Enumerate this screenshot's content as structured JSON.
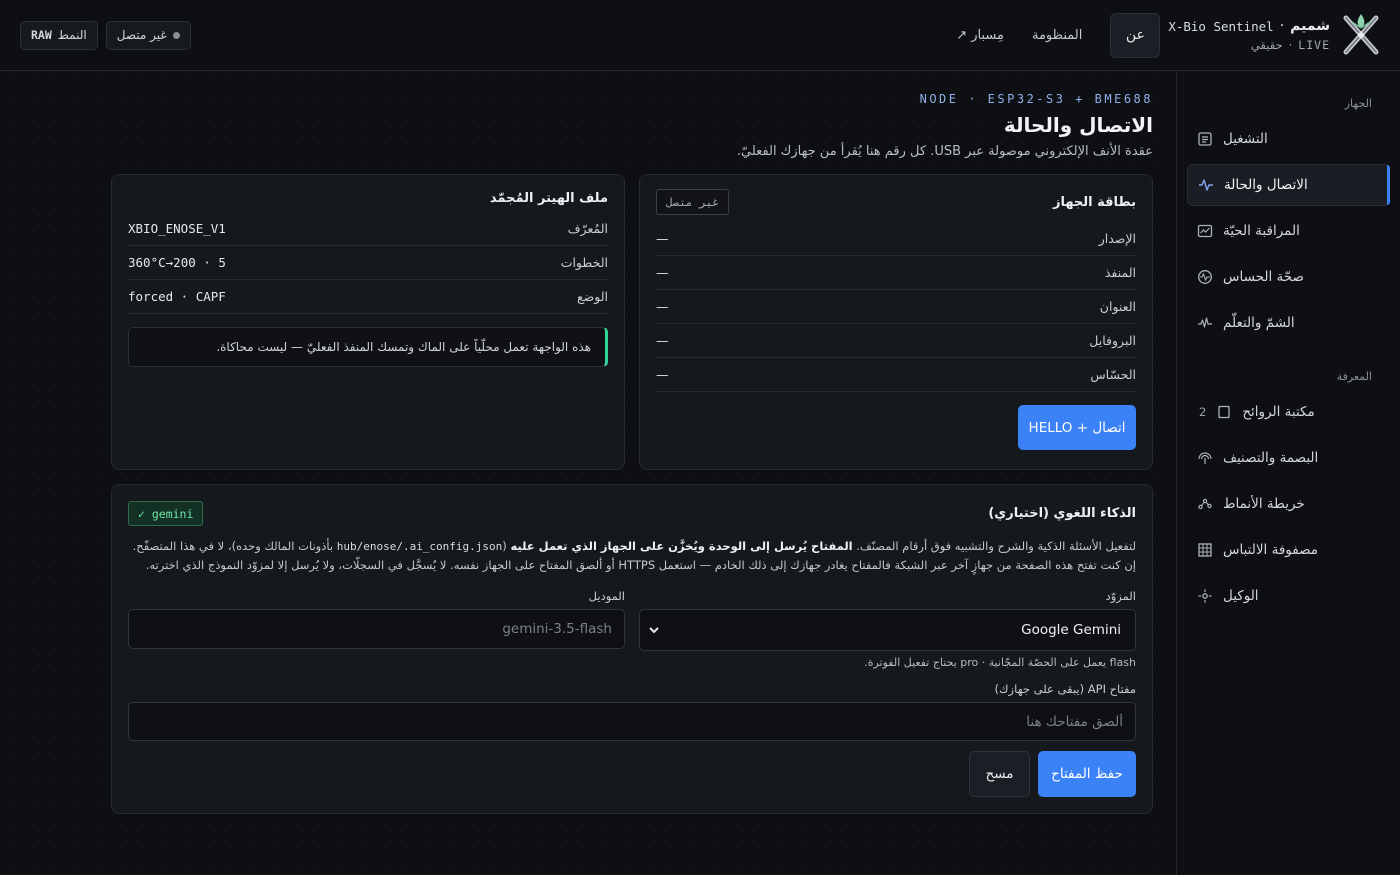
{
  "topbar": {
    "brand_name": "شميم",
    "brand_sep": "·",
    "product": "X-Bio Sentinel",
    "live": "LIVE",
    "live_sep": "·",
    "mode": "حقيقي",
    "lang": "عن",
    "nav": [
      "المنظومة",
      "مِسبار ↗"
    ],
    "status": "غير متصل",
    "mode_label": "النمط",
    "mode_value": "RAW"
  },
  "sidebar": {
    "group1": "الجهاز",
    "items1": [
      {
        "label": "التشغيل",
        "icon": "list-icon"
      },
      {
        "label": "الاتصال والحالة",
        "icon": "pulse-icon",
        "active": true
      },
      {
        "label": "المراقبة الحيّة",
        "icon": "chart-icon"
      },
      {
        "label": "صحّة الحساس",
        "icon": "heartbeat-icon"
      },
      {
        "label": "الشمّ والتعلّم",
        "icon": "signal-icon"
      }
    ],
    "group2": "المعرفة",
    "items2": [
      {
        "label": "مكتبة الروائح",
        "icon": "square-icon",
        "count": "2"
      },
      {
        "label": "البصمة والتصنيف",
        "icon": "fingerprint-icon"
      },
      {
        "label": "خريطة الأنماط",
        "icon": "scatter-icon"
      },
      {
        "label": "مصفوفة الالتباس",
        "icon": "grid-icon"
      },
      {
        "label": "الوكيل",
        "icon": "agent-icon"
      }
    ]
  },
  "main": {
    "eyebrow": "NODE · ESP32-S3 + BME688",
    "title": "الاتصال والحالة",
    "subtitle": "عقدة الأنف الإلكتروني موصولة عبر USB. كل رقم هنا يُقرأ من جهازك الفعليّ."
  },
  "device_card": {
    "title": "بطاقة الجهاز",
    "status_tag": "غير متصل",
    "rows": [
      {
        "k": "الإصدار",
        "v": "—"
      },
      {
        "k": "المنفذ",
        "v": "—"
      },
      {
        "k": "العنوان",
        "v": "—"
      },
      {
        "k": "البروفايل",
        "v": "—"
      },
      {
        "k": "الحسّاس",
        "v": "—"
      }
    ],
    "connect_label": "اتصال + HELLO"
  },
  "file_card": {
    "title": "ملف الهيتر المُجمّد",
    "rows": [
      {
        "k": "المُعرّف",
        "v": "XBIO_ENOSE_V1"
      },
      {
        "k": "الخطوات",
        "v": "5 · 200→360°C"
      },
      {
        "k": "الوضع",
        "v": "forced · CAPF"
      }
    ],
    "note": "هذه الواجهة تعمل محلّياً على الماك وتمسك المنفذ الفعليّ — ليست محاكاة."
  },
  "ai_card": {
    "title": "الذكاء اللغوي (اختياري)",
    "badge": "✓ gemini",
    "desc_1": "لتفعيل الأسئلة الذكية والشرح والتشبيه فوق أرقام المصنّف. ",
    "desc_bold": "المفتاح يُرسل إلى الوحدة ويُخزَّن على الجهاز الذي تعمل عليه",
    "desc_path": "hub/enose/.ai_config.json",
    "desc_2": " بأذونات المالك وحده)، لا في هذا المتصفّح. إن كنت تفتح هذه الصفحة من جهازٍ آخر عبر الشبكة فالمفتاح يغادر جهازك إلى ذلك الخادم — استعمل HTTPS أو ألصق المفتاح على الجهاز نفسه. لا يُسجَّل في السجلّات، ولا يُرسل إلا لمزوّد النموذج الذي اخترته.",
    "provider_label": "المزوّد",
    "provider_value": "Google Gemini",
    "model_label": "الموديل",
    "model_placeholder": "gemini-3.5-flash",
    "hint": "flash يعمل على الحصّة المجّانية · pro يحتاج تفعيل الفوترة.",
    "key_label": "مفتاح API (يبقى على جهازك)",
    "key_placeholder": "ألصق مفتاحك هنا",
    "save_label": "حفظ المفتاح",
    "clear_label": "مسح"
  },
  "colors": {
    "accent": "#3b82f6",
    "ok": "#34d399",
    "bg": "#0d0f13"
  }
}
